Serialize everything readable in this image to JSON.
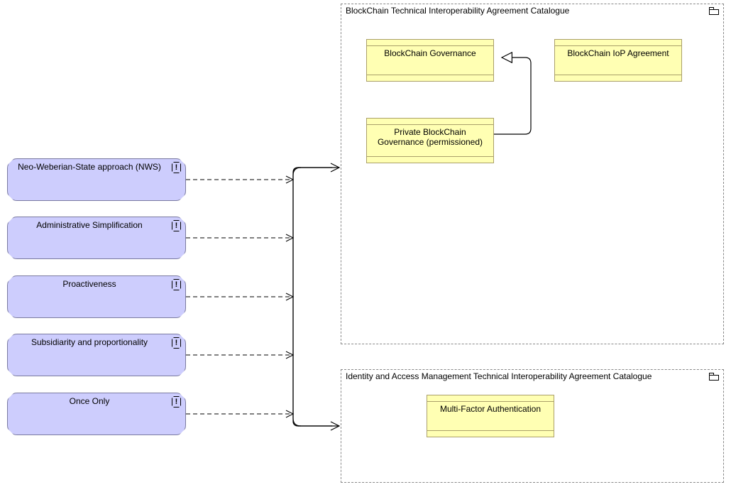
{
  "left_elements": [
    {
      "id": "nws",
      "label": "Neo-Weberian-State approach (NWS)"
    },
    {
      "id": "admin",
      "label": "Administrative Simplification"
    },
    {
      "id": "proact",
      "label": "Proactiveness"
    },
    {
      "id": "subs",
      "label": "Subsidiarity and proportionality"
    },
    {
      "id": "once",
      "label": "Once Only"
    }
  ],
  "groups": {
    "blockchain": {
      "title": "BlockChain Technical Interoperability Agreement Catalogue",
      "items": {
        "gov": "BlockChain Governance",
        "iop": "BlockChain IoP Agreement",
        "private": "Private BlockChain Governance (permissioned)"
      }
    },
    "iam": {
      "title": "Identity and Access Management Technical Interoperability Agreement Catalogue",
      "items": {
        "mfa": "Multi-Factor Authentication"
      }
    }
  },
  "glyph": "!"
}
